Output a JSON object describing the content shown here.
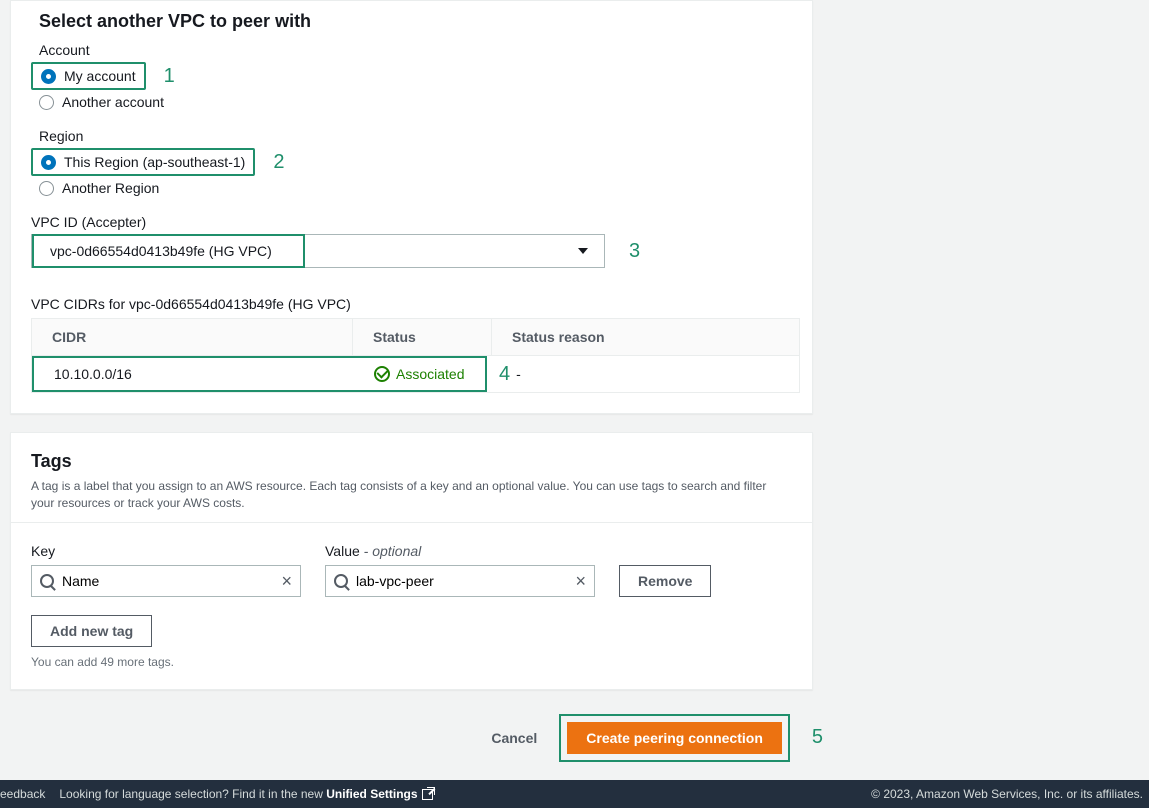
{
  "vpcPeer": {
    "sectionTitle": "Select another VPC to peer with",
    "accountLabel": "Account",
    "accountOptions": {
      "my": "My account",
      "another": "Another account"
    },
    "regionLabel": "Region",
    "regionOptions": {
      "this": "This Region (ap-southeast-1)",
      "another": "Another Region"
    },
    "vpcIdLabel": "VPC ID (Accepter)",
    "vpcIdValue": "vpc-0d66554d0413b49fe (HG VPC)",
    "cidrTableLabel": "VPC CIDRs for vpc-0d66554d0413b49fe (HG VPC)",
    "cidrHeaders": {
      "cidr": "CIDR",
      "status": "Status",
      "reason": "Status reason"
    },
    "cidrRow": {
      "cidr": "10.10.0.0/16",
      "status": "Associated",
      "reason": "-"
    }
  },
  "annotations": {
    "a1": "1",
    "a2": "2",
    "a3": "3",
    "a4": "4",
    "a5": "5"
  },
  "tags": {
    "title": "Tags",
    "desc": "A tag is a label that you assign to an AWS resource. Each tag consists of a key and an optional value. You can use tags to search and filter your resources or track your AWS costs.",
    "keyLabel": "Key",
    "valueLabelMain": "Value",
    "valueLabelOptional": " - optional",
    "keyValue": "Name",
    "valueValue": "lab-vpc-peer",
    "removeLabel": "Remove",
    "addLabel": "Add new tag",
    "limitText": "You can add 49 more tags."
  },
  "actions": {
    "cancel": "Cancel",
    "create": "Create peering connection"
  },
  "footer": {
    "feedback": "eedback",
    "langText": "Looking for language selection? Find it in the new ",
    "langLink": "Unified Settings",
    "copyright": "© 2023, Amazon Web Services, Inc. or its affiliates."
  }
}
